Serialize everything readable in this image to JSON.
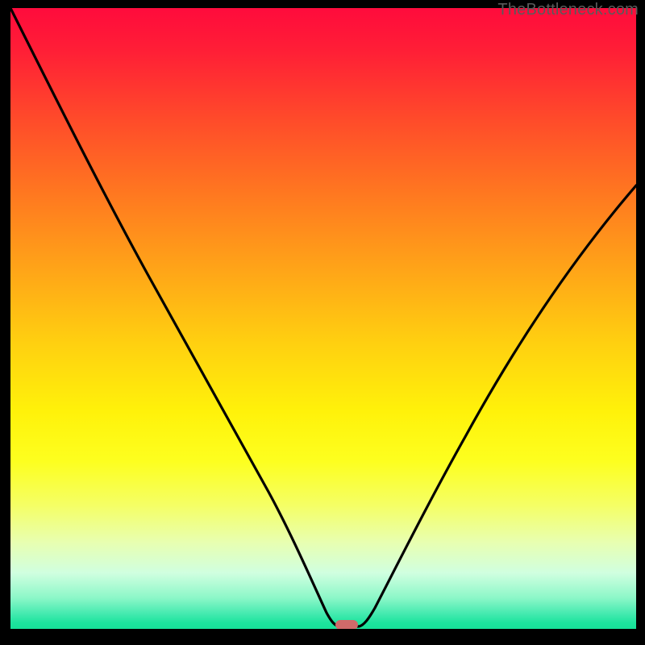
{
  "watermark": "TheBottleneck.com",
  "chart_data": {
    "type": "line",
    "title": "",
    "xlabel": "",
    "ylabel": "",
    "xlim": [
      0,
      100
    ],
    "ylim": [
      0,
      100
    ],
    "grid": false,
    "legend": "none",
    "background": "red-yellow-green vertical gradient",
    "series": [
      {
        "name": "bottleneck-curve",
        "color": "#000000",
        "x": [
          0,
          5,
          10,
          15,
          20,
          25,
          30,
          35,
          40,
          45,
          48,
          50,
          52,
          54,
          56,
          60,
          65,
          70,
          75,
          80,
          85,
          90,
          95,
          100
        ],
        "values": [
          100,
          90,
          79,
          68,
          57.5,
          47.5,
          38,
          29,
          20.5,
          11.5,
          5,
          1,
          0,
          0,
          1,
          8,
          18,
          27.5,
          36.5,
          45,
          52.5,
          59.5,
          66,
          71.5
        ]
      }
    ],
    "marker": {
      "name": "optimal-point",
      "shape": "rounded-pill",
      "color": "#cf6a6a",
      "x": 53,
      "y": 0,
      "width_pct": 3.4,
      "height_pct": 1.6
    }
  }
}
